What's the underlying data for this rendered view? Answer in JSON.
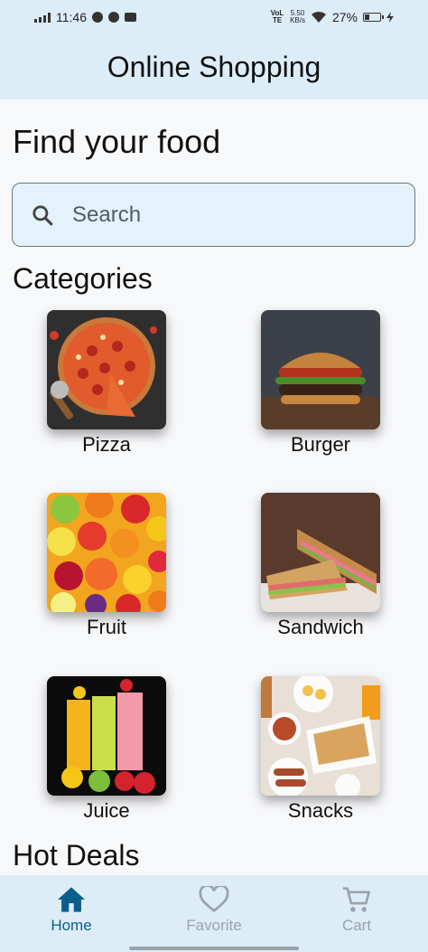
{
  "status_bar": {
    "time": "11:46",
    "volte": "VoLTE",
    "speed_value": "5.50",
    "speed_unit": "KB/s",
    "battery": "27%"
  },
  "app_bar": {
    "title": "Online Shopping"
  },
  "main": {
    "heading": "Find your food",
    "search": {
      "placeholder": "Search",
      "icon": "search-icon"
    },
    "categories_heading": "Categories",
    "categories": [
      {
        "label": "Pizza"
      },
      {
        "label": "Burger"
      },
      {
        "label": "Fruit"
      },
      {
        "label": "Sandwich"
      },
      {
        "label": "Juice"
      },
      {
        "label": "Snacks"
      }
    ],
    "hot_deals_heading": "Hot Deals"
  },
  "bottom_nav": {
    "items": [
      {
        "label": "Home",
        "icon": "home-icon",
        "active": true
      },
      {
        "label": "Favorite",
        "icon": "heart-icon",
        "active": false
      },
      {
        "label": "Cart",
        "icon": "cart-icon",
        "active": false
      }
    ]
  },
  "colors": {
    "bar_bg": "#dcedf8",
    "accent": "#0b5e8a",
    "inactive": "#9aa3a8",
    "search_bg": "#e3f2fb"
  }
}
